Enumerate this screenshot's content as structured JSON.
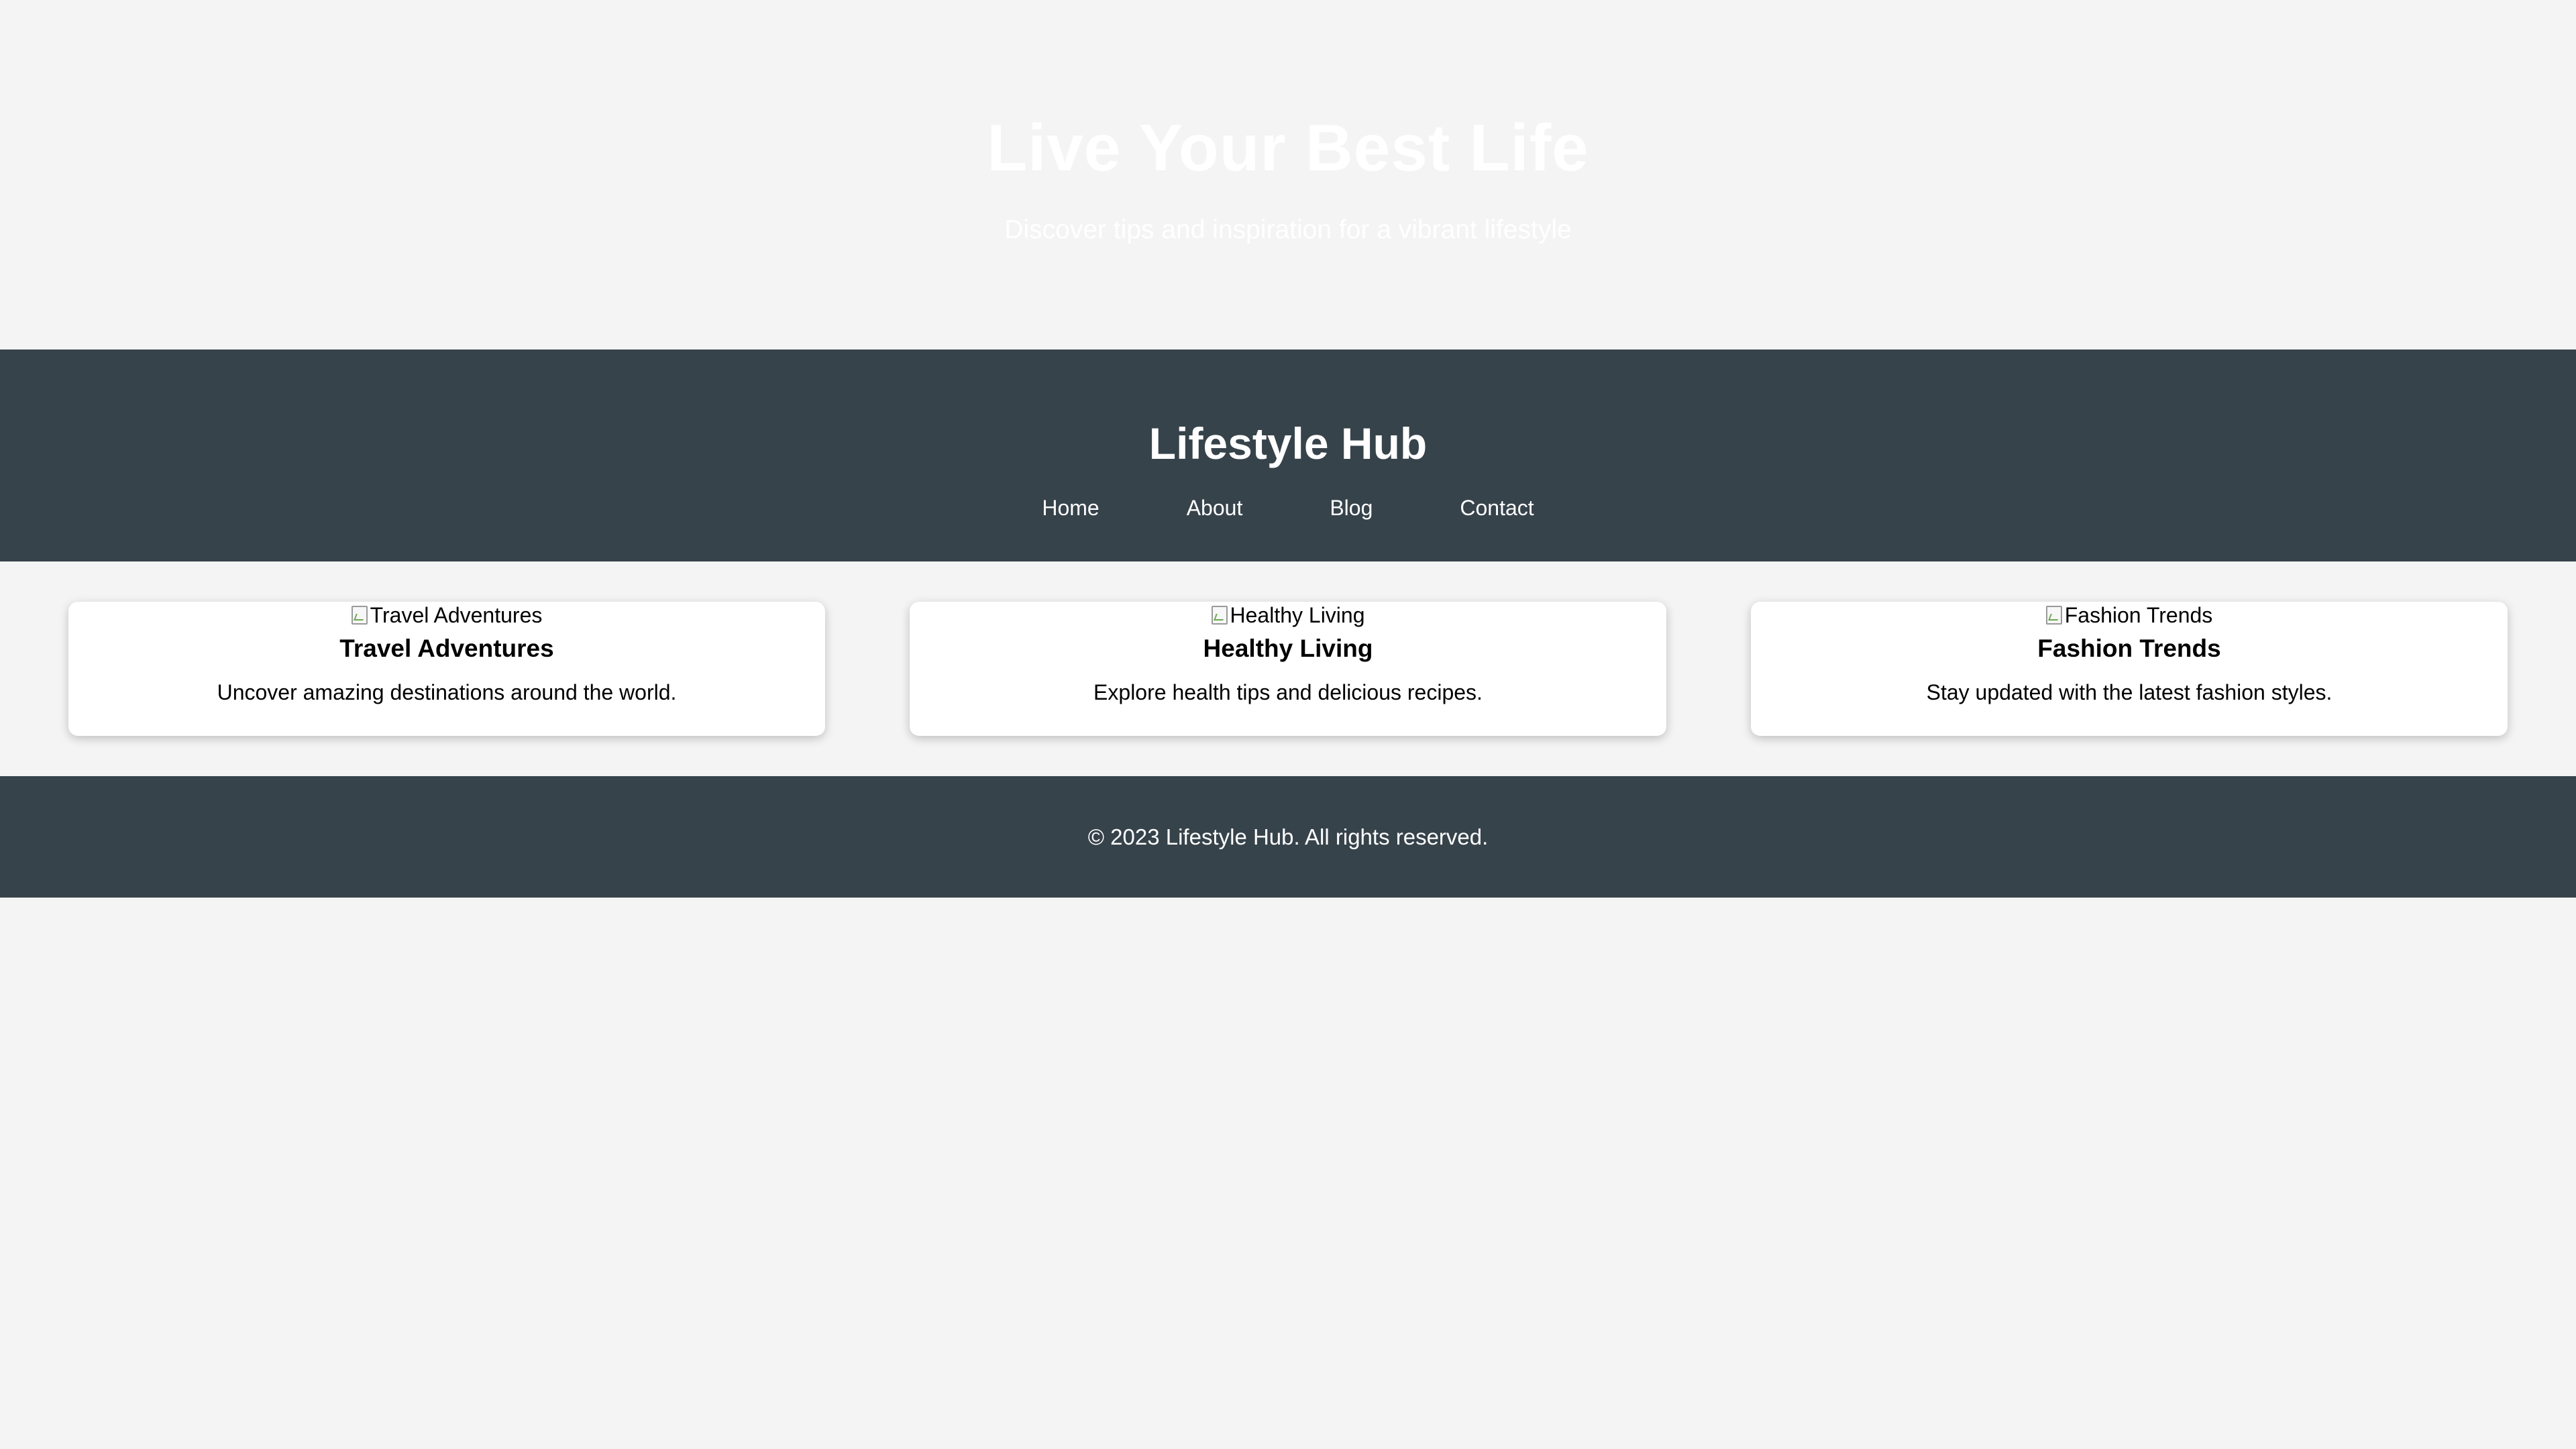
{
  "hero": {
    "title": "Live Your Best Life",
    "subtitle": "Discover tips and inspiration for a vibrant lifestyle"
  },
  "header": {
    "site_title": "Lifestyle Hub",
    "nav": [
      {
        "label": "Home"
      },
      {
        "label": "About"
      },
      {
        "label": "Blog"
      },
      {
        "label": "Contact"
      }
    ]
  },
  "cards": [
    {
      "image_alt": "Travel Adventures",
      "title": "Travel Adventures",
      "description": "Uncover amazing destinations around the world."
    },
    {
      "image_alt": "Healthy Living",
      "title": "Healthy Living",
      "description": "Explore health tips and delicious recipes."
    },
    {
      "image_alt": "Fashion Trends",
      "title": "Fashion Trends",
      "description": "Stay updated with the latest fashion styles."
    }
  ],
  "footer": {
    "text": "© 2023 Lifestyle Hub. All rights reserved."
  },
  "colors": {
    "page_background": "#f4f4f4",
    "header_background": "#37434b",
    "card_background": "#ffffff",
    "hero_text": "#ffffff"
  },
  "icons": {
    "card_image": "broken-image-icon"
  }
}
